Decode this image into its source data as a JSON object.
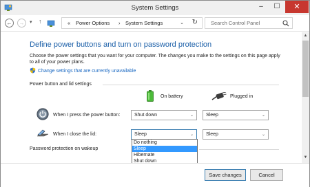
{
  "window": {
    "title": "System Settings",
    "minimize": "–",
    "maximize": "☐",
    "close": "✕"
  },
  "nav": {
    "back": "←",
    "forward": "→",
    "recent": "▾",
    "up": "↑",
    "breadcrumb_prefix": "«",
    "breadcrumb": [
      "Power Options",
      "System Settings"
    ],
    "separator": "›",
    "address_dropdown": "⌄",
    "refresh": "↻",
    "search_placeholder": "Search Control Panel"
  },
  "content": {
    "heading": "Define power buttons and turn on password protection",
    "description": "Choose the power settings that you want for your computer. The changes you make to the settings on this page apply to all of your power plans.",
    "change_settings_link": "Change settings that are currently unavailable",
    "section_buttons": "Power button and lid settings",
    "col_battery": "On battery",
    "col_plugged": "Plugged in",
    "rows": [
      {
        "label": "When I press the power button:",
        "battery": "Shut down",
        "plugged": "Sleep"
      },
      {
        "label": "When I close the lid:",
        "battery": "Sleep",
        "plugged": "Sleep"
      }
    ],
    "dropdown_options": [
      "Do nothing",
      "Sleep",
      "Hibernate",
      "Shut down"
    ],
    "dropdown_selected": "Sleep",
    "section_password": "Password protection on wakeup"
  },
  "footer": {
    "save_label": "Save changes",
    "cancel_label": "Cancel"
  },
  "colors": {
    "heading": "#1b5fa8",
    "link": "#1565c0",
    "close_button": "#c7372f",
    "dropdown_highlight": "#3399ff"
  },
  "icons": {
    "app": "control-panel-icon",
    "battery": "battery-icon",
    "plug": "plug-icon",
    "power_button": "power-button-icon",
    "lid": "laptop-lid-icon",
    "shield": "uac-shield-icon",
    "search": "search-icon"
  }
}
